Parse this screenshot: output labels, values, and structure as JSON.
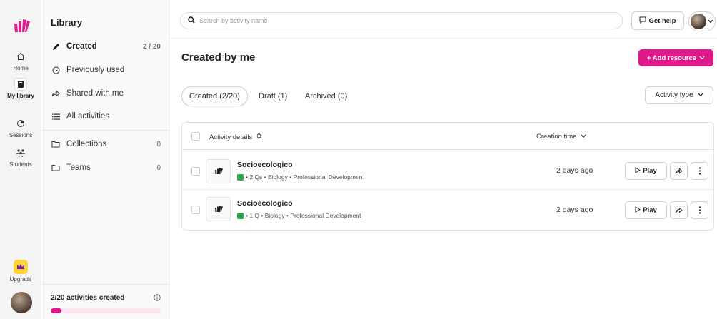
{
  "rail": {
    "items": [
      {
        "label": "Home",
        "icon": "home-icon"
      },
      {
        "label": "My library",
        "icon": "library-icon"
      },
      {
        "label": "Sessions",
        "icon": "sessions-icon"
      },
      {
        "label": "Students",
        "icon": "students-icon"
      }
    ],
    "upgrade_label": "Upgrade"
  },
  "library": {
    "title": "Library",
    "items": [
      {
        "label": "Created",
        "count": "2 / 20",
        "icon": "pencil-icon"
      },
      {
        "label": "Previously used",
        "count": "",
        "icon": "clock-icon"
      },
      {
        "label": "Shared with me",
        "count": "",
        "icon": "share-icon"
      },
      {
        "label": "All activities",
        "count": "",
        "icon": "list-icon"
      }
    ],
    "groups": [
      {
        "label": "Collections",
        "count": "0",
        "icon": "folder-icon"
      },
      {
        "label": "Teams",
        "count": "0",
        "icon": "folder-icon"
      }
    ],
    "footer_text": "2/20 activities created",
    "progress_fraction": 0.1
  },
  "topbar": {
    "search_placeholder": "Search by activity name",
    "help_label": "Get help"
  },
  "main": {
    "title": "Created by me",
    "add_label": "+ Add resource",
    "tabs": [
      {
        "label": "Created (2/20)",
        "active": true
      },
      {
        "label": "Draft (1)",
        "active": false
      },
      {
        "label": "Archived (0)",
        "active": false
      }
    ],
    "filter_label": "Activity type"
  },
  "table": {
    "col_details": "Activity details",
    "col_time": "Creation time",
    "rows": [
      {
        "title": "Socioecologico",
        "meta": "• 2 Qs • Biology • Professional Development",
        "time": "2 days ago",
        "play": "Play"
      },
      {
        "title": "Socioecologico",
        "meta": "• 1 Q • Biology • Professional Development",
        "time": "2 days ago",
        "play": "Play"
      }
    ]
  },
  "colors": {
    "accent": "#e0198b",
    "upgrade": "#ffd43b",
    "question_badge": "#2fa84f"
  }
}
